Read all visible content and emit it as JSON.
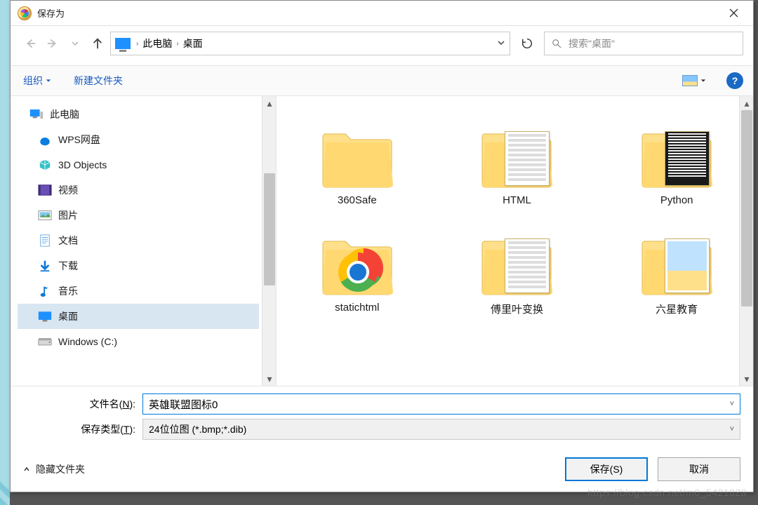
{
  "title": "保存为",
  "breadcrumb": {
    "part1": "此电脑",
    "part2": "桌面"
  },
  "search_placeholder": "搜索\"桌面\"",
  "toolbar": {
    "organize": "组织",
    "newfolder": "新建文件夹"
  },
  "tree": {
    "root": "此电脑",
    "items": [
      {
        "label": "WPS网盘",
        "icon": "wps"
      },
      {
        "label": "3D Objects",
        "icon": "cube"
      },
      {
        "label": "视频",
        "icon": "video"
      },
      {
        "label": "图片",
        "icon": "pic"
      },
      {
        "label": "文档",
        "icon": "doc"
      },
      {
        "label": "下载",
        "icon": "down"
      },
      {
        "label": "音乐",
        "icon": "music"
      },
      {
        "label": "桌面",
        "icon": "desk",
        "selected": true
      },
      {
        "label": "Windows (C:)",
        "icon": "disk"
      }
    ]
  },
  "folders": [
    {
      "name": "360Safe",
      "kind": "empty"
    },
    {
      "name": "HTML",
      "kind": "text"
    },
    {
      "name": "Python",
      "kind": "code"
    },
    {
      "name": "statichtml",
      "kind": "chrome"
    },
    {
      "name": "傅里叶变换",
      "kind": "text2"
    },
    {
      "name": "六星教育",
      "kind": "image"
    }
  ],
  "form": {
    "name_label_pre": "文件名(",
    "name_label_u": "N",
    "name_label_post": "):",
    "type_label_pre": "保存类型(",
    "type_label_u": "T",
    "type_label_post": "):",
    "filename": "英雄联盟图标0",
    "filetype": "24位位图 (*.bmp;*.dib)"
  },
  "footer": {
    "hide": "隐藏文件夹",
    "save": "保存(S)",
    "cancel": "取消"
  },
  "watermark": "https://blog.csdn.net/m0_5421828"
}
